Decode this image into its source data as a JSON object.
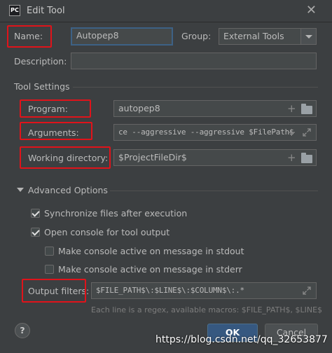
{
  "window": {
    "title": "Edit Tool",
    "app_icon_text": "PC"
  },
  "name": {
    "label": "Name:",
    "value": "Autopep8"
  },
  "group": {
    "label": "Group:",
    "value": "External Tools"
  },
  "description": {
    "label": "Description:",
    "value": ""
  },
  "tool_settings": {
    "title": "Tool Settings",
    "program": {
      "label": "Program:",
      "value": "autopep8"
    },
    "arguments": {
      "label": "Arguments:",
      "value": "ce --aggressive --aggressive $FilePath$"
    },
    "working_directory": {
      "label": "Working directory:",
      "value": "$ProjectFileDir$"
    }
  },
  "advanced": {
    "title": "Advanced Options",
    "sync_files": {
      "label": "Synchronize files after execution",
      "checked": true
    },
    "open_console": {
      "label": "Open console for tool output",
      "checked": true
    },
    "active_stdout": {
      "label": "Make console active on message in stdout",
      "checked": false
    },
    "active_stderr": {
      "label": "Make console active on message in stderr",
      "checked": false
    },
    "output_filters": {
      "label": "Output filters:",
      "value": "$FILE_PATH$\\:$LINE$\\:$COLUMN$\\:.*"
    },
    "hint": "Each line is a regex, available macros: $FILE_PATH$, $LINE$"
  },
  "buttons": {
    "help": "?",
    "ok": "OK",
    "cancel": "Cancel"
  },
  "watermark": "https://blog.csdn.net/qq_32653877"
}
